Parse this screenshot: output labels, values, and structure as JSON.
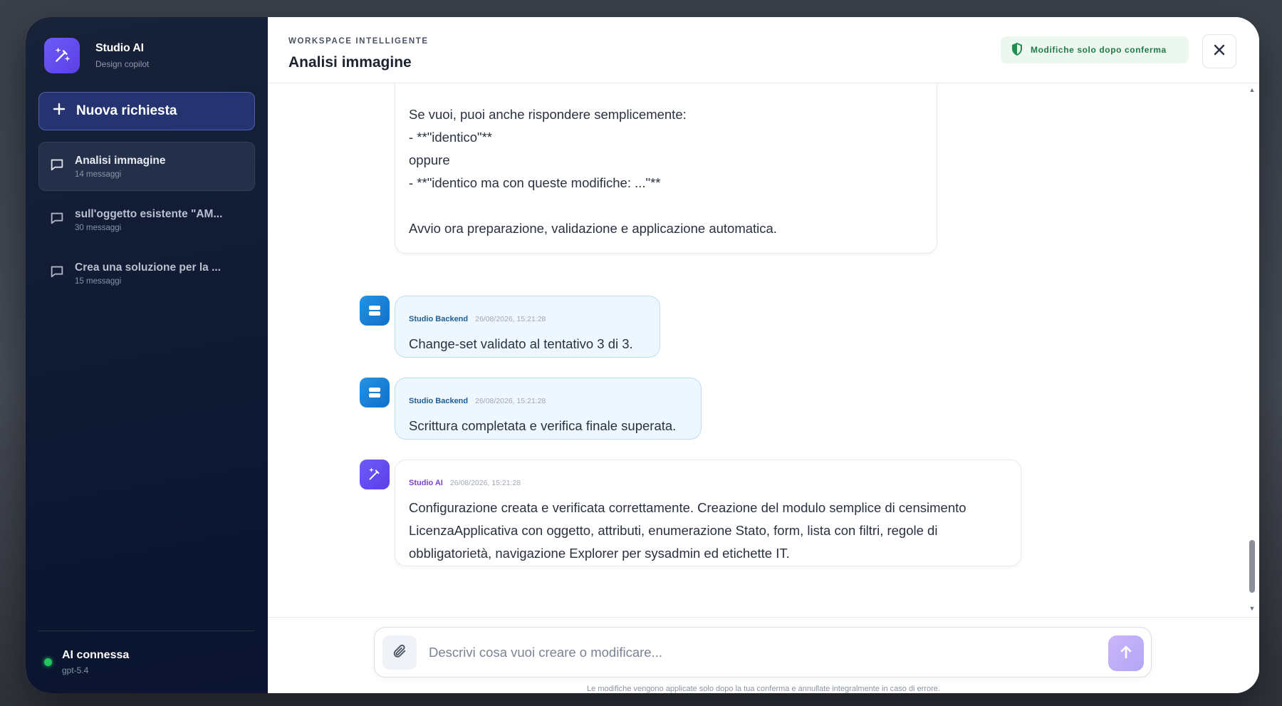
{
  "sidebar": {
    "brand_name": "Studio AI",
    "brand_sub": "Design copilot",
    "new_request": "Nuova richiesta",
    "conversations": [
      {
        "title": "Analisi immagine",
        "count": "14 messaggi"
      },
      {
        "title": "sull'oggetto esistente \"AM...",
        "count": "30 messaggi"
      },
      {
        "title": "Crea una soluzione per la ...",
        "count": "15 messaggi"
      }
    ],
    "status_title": "AI connessa",
    "status_model": "gpt-5.4"
  },
  "header": {
    "overline": "WORKSPACE INTELLIGENTE",
    "title": "Analisi immagine",
    "badge": "Modifiche solo dopo conferma"
  },
  "messages": {
    "first": {
      "lines": [
        "Se vuoi, puoi anche rispondere semplicemente:",
        "- **\"identico\"**",
        "oppure",
        "- **\"identico ma con queste modifiche: ...\"**",
        "Avvio ora preparazione, validazione e applicazione automatica."
      ]
    },
    "backend1": {
      "author": "Studio Backend",
      "time": "26/08/2026, 15:21:28",
      "text": "Change-set validato al tentativo 3 di 3."
    },
    "backend2": {
      "author": "Studio Backend",
      "time": "26/08/2026, 15:21:28",
      "text": "Scrittura completata e verifica finale superata."
    },
    "ai": {
      "author": "Studio AI",
      "time": "26/08/2026, 15:21:28",
      "lines": [
        "Configurazione creata e verificata correttamente. Creazione del modulo semplice di censimento",
        "LicenzaApplicativa con oggetto, attributi, enumerazione Stato, form, lista con filtri, regole di",
        "obbligatorietà, navigazione Explorer per sysadmin ed etichette IT."
      ]
    }
  },
  "composer": {
    "placeholder": "Descrivi cosa vuoi creare o modificare...",
    "disclaimer": "Le modifiche vengono applicate solo dopo la tua conferma e annullate integralmente in caso di errore."
  },
  "colors": {
    "accent": "#5b3fe6",
    "backend": "#1270c7",
    "success": "#22c55e",
    "sidebar_bg": "#101a33"
  }
}
